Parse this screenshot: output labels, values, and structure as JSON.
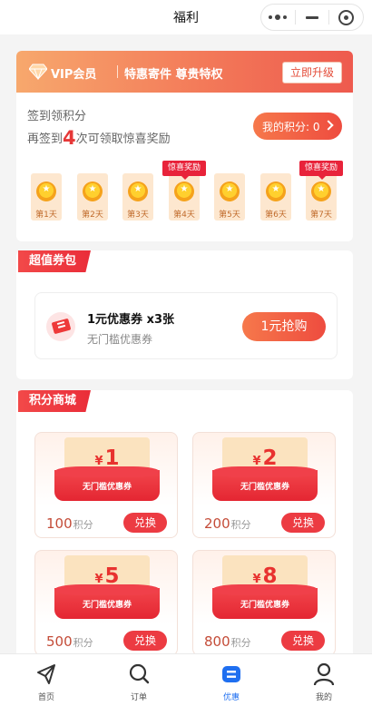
{
  "header": {
    "title": "福利",
    "menu_icon": "more-dots-icon",
    "minimize_icon": "minus-icon",
    "close_icon": "target-icon"
  },
  "vip": {
    "icon": "diamond-icon",
    "label": "VIP会员",
    "slogan": "特惠寄件 尊贵特权",
    "upgrade_label": "立即升级"
  },
  "signin": {
    "title": "签到领积分",
    "sub_prefix": "再签到",
    "sub_count": "4",
    "sub_suffix": "次可领取惊喜奖励",
    "points_label": "我的积分: 0",
    "points_icon": "chevron-right-icon",
    "days": [
      {
        "label": "第1天",
        "badge": ""
      },
      {
        "label": "第2天",
        "badge": ""
      },
      {
        "label": "第3天",
        "badge": ""
      },
      {
        "label": "第4天",
        "badge": "惊喜奖励"
      },
      {
        "label": "第5天",
        "badge": ""
      },
      {
        "label": "第6天",
        "badge": ""
      },
      {
        "label": "第7天",
        "badge": "惊喜奖励"
      }
    ]
  },
  "coupon_pack": {
    "section_title": "超值券包",
    "icon": "ticket-icon",
    "title": "1元优惠券 x3张",
    "desc": "无门槛优惠券",
    "buy_label": "1元抢购"
  },
  "shop": {
    "section_title": "积分商城",
    "items": [
      {
        "currency": "¥",
        "amount": "1",
        "tag": "无门槛优惠券",
        "points": "100",
        "unit": "积分",
        "button": "兑换"
      },
      {
        "currency": "¥",
        "amount": "2",
        "tag": "无门槛优惠券",
        "points": "200",
        "unit": "积分",
        "button": "兑换"
      },
      {
        "currency": "¥",
        "amount": "5",
        "tag": "无门槛优惠券",
        "points": "500",
        "unit": "积分",
        "button": "兑换"
      },
      {
        "currency": "¥",
        "amount": "8",
        "tag": "无门槛优惠券",
        "points": "800",
        "unit": "积分",
        "button": "兑换"
      }
    ]
  },
  "tabbar": {
    "tabs": [
      {
        "label": "首页",
        "icon": "paper-plane-icon"
      },
      {
        "label": "订单",
        "icon": "search-icon"
      },
      {
        "label": "优惠",
        "icon": "discount-icon",
        "active": true
      },
      {
        "label": "我的",
        "icon": "person-icon"
      }
    ]
  },
  "colors": {
    "accent": "#ee4c3f",
    "tab_active": "#1f6ff0",
    "coin": "#f5a21b"
  }
}
